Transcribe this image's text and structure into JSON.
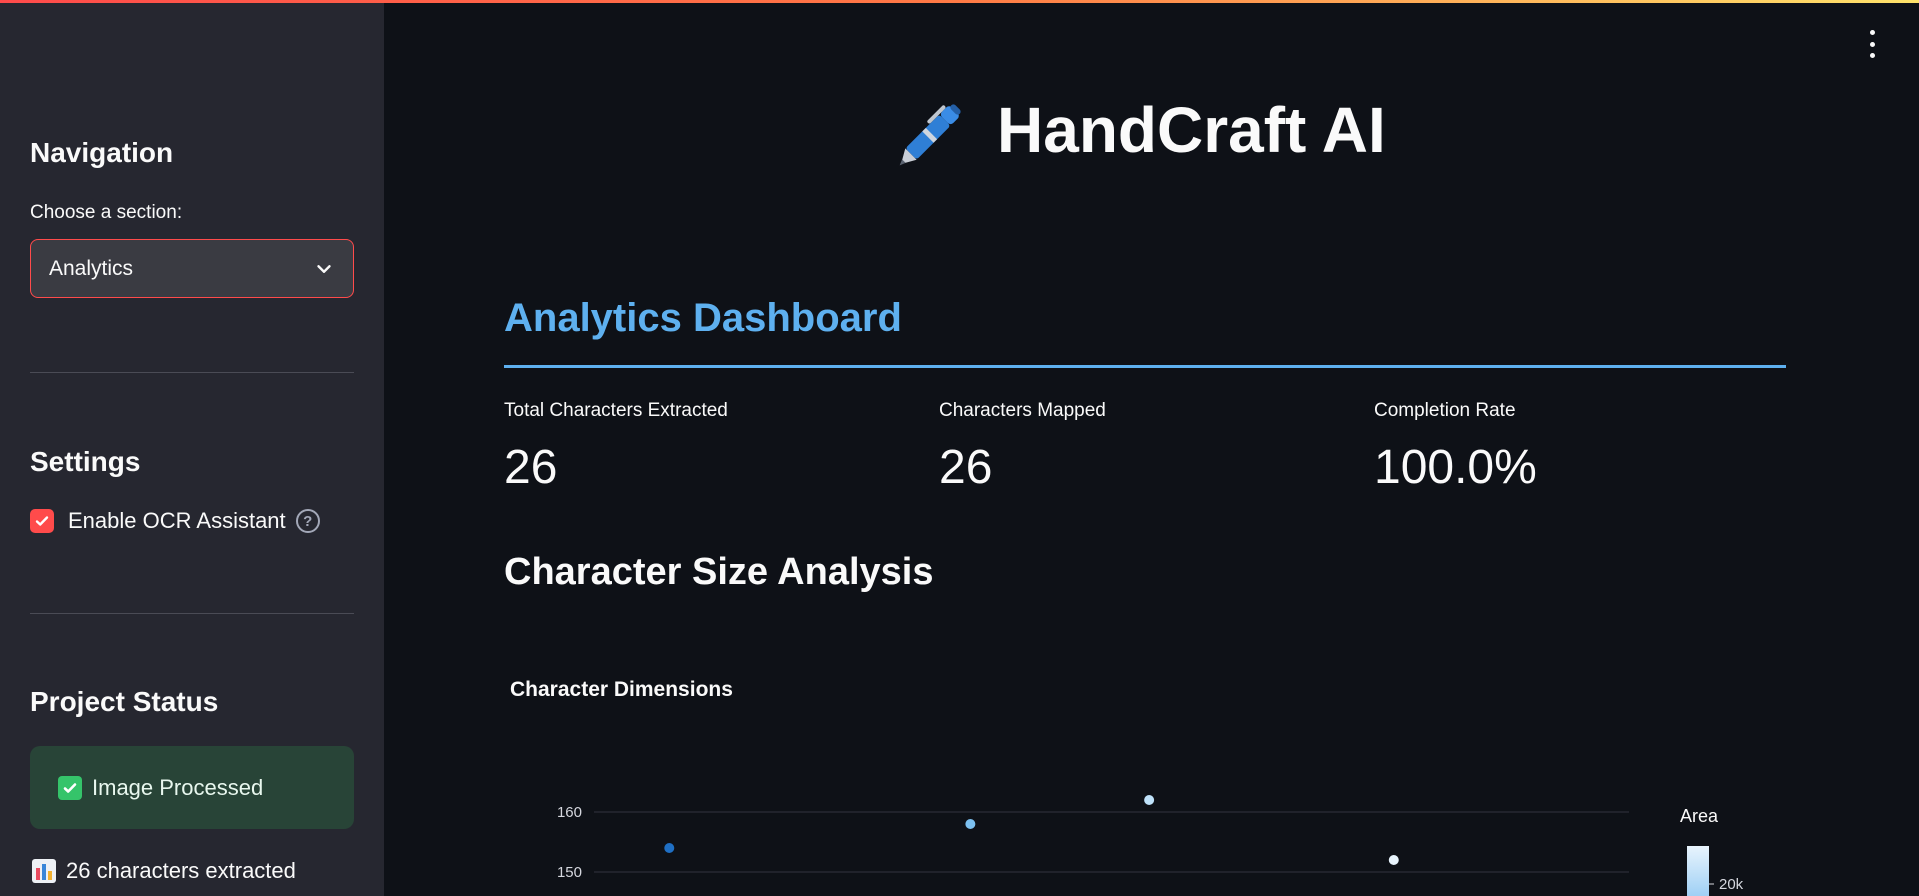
{
  "sidebar": {
    "navigation_title": "Navigation",
    "choose_label": "Choose a section:",
    "selected_section": "Analytics",
    "settings_title": "Settings",
    "ocr_label": "Enable OCR Assistant",
    "ocr_checked": true,
    "status_title": "Project Status",
    "status_message": "Image Processed",
    "chars_extracted": "26 characters extracted"
  },
  "header": {
    "title": "HandCraft AI",
    "icon": "pen-icon"
  },
  "main": {
    "section_title": "Analytics Dashboard",
    "metrics": [
      {
        "label": "Total Characters Extracted",
        "value": "26"
      },
      {
        "label": "Characters Mapped",
        "value": "26"
      },
      {
        "label": "Completion Rate",
        "value": "100.0%"
      }
    ],
    "subheader": "Character Size Analysis"
  },
  "colors": {
    "accent": "#ff4b4b",
    "heading_blue": "#5eb0ef",
    "success_bg": "#284437",
    "sidebar_bg": "#262730",
    "main_bg": "#0e1117"
  },
  "chart_data": {
    "type": "scatter",
    "title": "Character Dimensions",
    "xlabel": "",
    "ylabel": "",
    "yticks": [
      150,
      160
    ],
    "ytick_labels": [
      "150",
      "160"
    ],
    "legend_title": "Area",
    "legend_tick": "20k",
    "legend_placement": "right",
    "grid": true,
    "points": [
      {
        "x": 1,
        "y": 154,
        "color": "#1f6fc4"
      },
      {
        "x": 2.6,
        "y": 158,
        "color": "#7cc0f0"
      },
      {
        "x": 3.55,
        "y": 162,
        "color": "#bfe2fa"
      },
      {
        "x": 4.85,
        "y": 152,
        "color": "#e8f4fd"
      }
    ]
  }
}
